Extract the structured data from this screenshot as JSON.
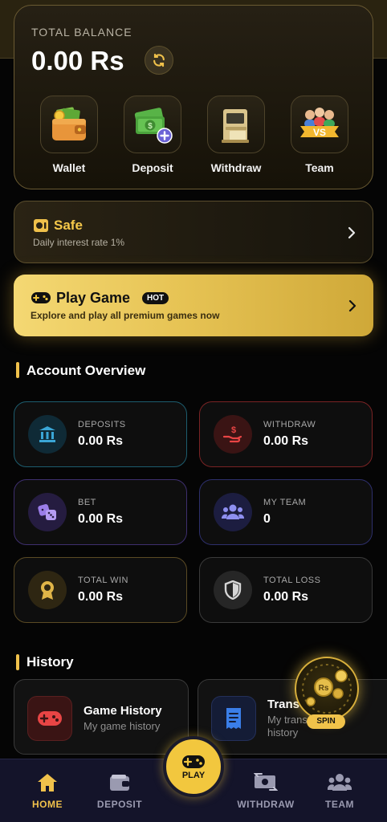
{
  "balance": {
    "title": "TOTAL BALANCE",
    "value": "0.00 Rs",
    "refresh_icon": "refresh-icon"
  },
  "quick_actions": [
    {
      "label": "Wallet",
      "icon": "wallet-icon"
    },
    {
      "label": "Deposit",
      "icon": "deposit-money-icon"
    },
    {
      "label": "Withdraw",
      "icon": "withdraw-atm-icon"
    },
    {
      "label": "Team",
      "icon": "team-vs-icon"
    }
  ],
  "safe": {
    "title": "Safe",
    "subtitle": "Daily interest rate 1%"
  },
  "play_game": {
    "title": "Play Game",
    "badge": "HOT",
    "subtitle": "Explore and play all premium games now"
  },
  "overview": {
    "title": "Account Overview",
    "cards": [
      {
        "label": "DEPOSITS",
        "value": "0.00 Rs",
        "icon": "bank-icon",
        "accent": "#1d5d6e"
      },
      {
        "label": "WITHDRAW",
        "value": "0.00 Rs",
        "icon": "hand-money-icon",
        "accent": "#7a2324"
      },
      {
        "label": "BET",
        "value": "0.00 Rs",
        "icon": "dice-icon",
        "accent": "#3e2f6e"
      },
      {
        "label": "MY TEAM",
        "value": "0",
        "icon": "users-icon",
        "accent": "#2d2f6b"
      },
      {
        "label": "TOTAL WIN",
        "value": "0.00 Rs",
        "icon": "award-icon",
        "accent": "#5a4a24"
      },
      {
        "label": "TOTAL LOSS",
        "value": "0.00 Rs",
        "icon": "shield-icon",
        "accent": "#3a3a3a"
      }
    ]
  },
  "history": {
    "title": "History",
    "items": [
      {
        "title": "Game History",
        "subtitle": "My game history",
        "icon": "gamepad-icon"
      },
      {
        "title": "Trans",
        "subtitle": "My trans",
        "subtitle2": "history",
        "icon": "receipt-icon"
      }
    ]
  },
  "spin": {
    "label": "SPIN",
    "coin_text": "Rs"
  },
  "nav": {
    "items": [
      {
        "label": "HOME",
        "icon": "home-icon",
        "active": true
      },
      {
        "label": "DEPOSIT",
        "icon": "wallet-icon",
        "active": false
      },
      {
        "label": "PLAY",
        "icon": "gamepad-icon",
        "active": false
      },
      {
        "label": "WITHDRAW",
        "icon": "money-exchange-icon",
        "active": false
      },
      {
        "label": "TEAM",
        "icon": "users-icon",
        "active": false
      }
    ]
  },
  "colors": {
    "accent": "#f0c14b",
    "background": "#050505",
    "nav_background": "#14142a"
  }
}
